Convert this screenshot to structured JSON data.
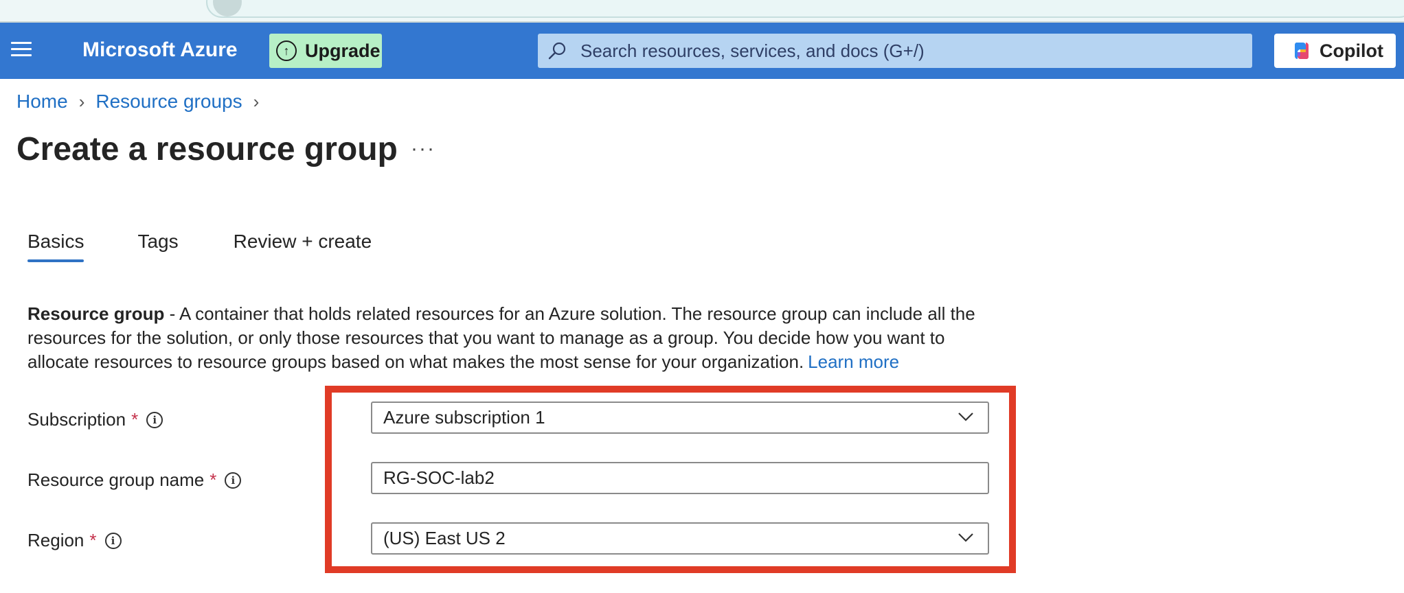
{
  "header": {
    "brand": "Microsoft Azure",
    "upgrade_label": "Upgrade",
    "search_placeholder": "Search resources, services, and docs (G+/)",
    "copilot_label": "Copilot"
  },
  "breadcrumb": {
    "items": [
      "Home",
      "Resource groups"
    ]
  },
  "page": {
    "title": "Create a resource group",
    "more": "···"
  },
  "tabs": [
    {
      "label": "Basics",
      "active": true
    },
    {
      "label": "Tags",
      "active": false
    },
    {
      "label": "Review + create",
      "active": false
    }
  ],
  "description": {
    "bold": "Resource group",
    "text": " - A container that holds related resources for an Azure solution. The resource group can include all the resources for the solution, or only those resources that you want to manage as a group. You decide how you want to allocate resources to resource groups based on what makes the most sense for your organization.",
    "link": "Learn more"
  },
  "form": {
    "subscription": {
      "label": "Subscription",
      "value": "Azure subscription 1"
    },
    "resource_group_name": {
      "label": "Resource group name",
      "value": "RG-SOC-lab2"
    },
    "region": {
      "label": "Region",
      "value": "(US) East US 2"
    },
    "required_marker": "*",
    "info_glyph": "i"
  },
  "colors": {
    "topbar": "#3377d0",
    "upgrade_bg": "#b7f0c6",
    "search_bg": "#b6d4f2",
    "link": "#1f6fc4",
    "highlight": "#e03b26"
  }
}
